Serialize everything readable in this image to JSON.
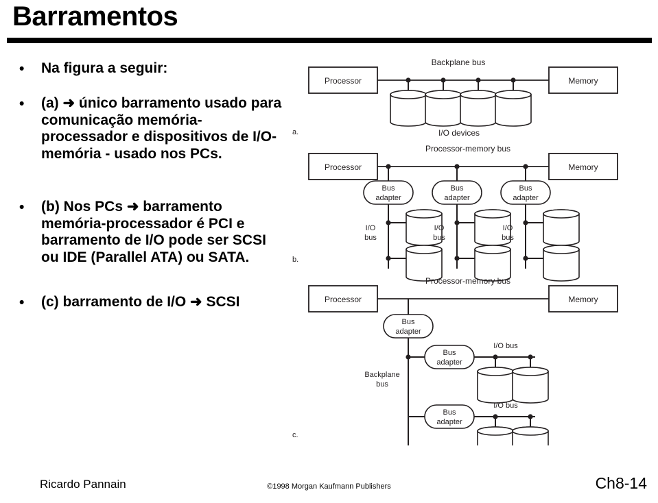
{
  "title": "Barramentos",
  "bullets": [
    {
      "id": "intro",
      "text": "Na figura a seguir:"
    },
    {
      "id": "item-a",
      "text": "(a) ➜ único barramento usado para comunicação memória-processador e dispositivos de I/O-memória   - usado nos PCs."
    },
    {
      "id": "item-b",
      "text": "(b) Nos PCs ➜ barramento memória-processador é PCI e barramento de I/O pode ser SCSI ou IDE (Parallel ATA) ou SATA."
    },
    {
      "id": "item-c",
      "text": "(c) barramento de I/O ➜  SCSI"
    }
  ],
  "bullet_marker": "•",
  "figure": {
    "part_a": {
      "caption": "a.",
      "processor": "Processor",
      "memory": "Memory",
      "bus_label": "Backplane bus",
      "devices_label": "I/O devices",
      "device_count": 4
    },
    "part_b": {
      "caption": "b.",
      "processor": "Processor",
      "memory": "Memory",
      "bus_label": "Processor-memory bus",
      "adapter_label_line1": "Bus",
      "adapter_label_line2": "adapter",
      "adapter_count": 3,
      "io_bus_label_line1": "I/O",
      "io_bus_label_line2": "bus",
      "devices_per_bus": 2
    },
    "part_c": {
      "caption": "c.",
      "processor": "Processor",
      "memory": "Memory",
      "bus_label": "Processor-memory bus",
      "adapter_label_line1": "Bus",
      "adapter_label_line2": "adapter",
      "backplane_label_line1": "Backplane",
      "backplane_label_line2": "bus",
      "io_bus_label": "I/O bus",
      "io_bus_count": 2,
      "devices_per_bus": 2
    }
  },
  "footer": {
    "author": "Ricardo Pannain",
    "copyright": "©1998 Morgan Kaufmann Publishers",
    "chapter": "Ch8-14"
  },
  "colors": {
    "ink": "#000000",
    "background": "#ffffff",
    "line": "#231f20"
  }
}
